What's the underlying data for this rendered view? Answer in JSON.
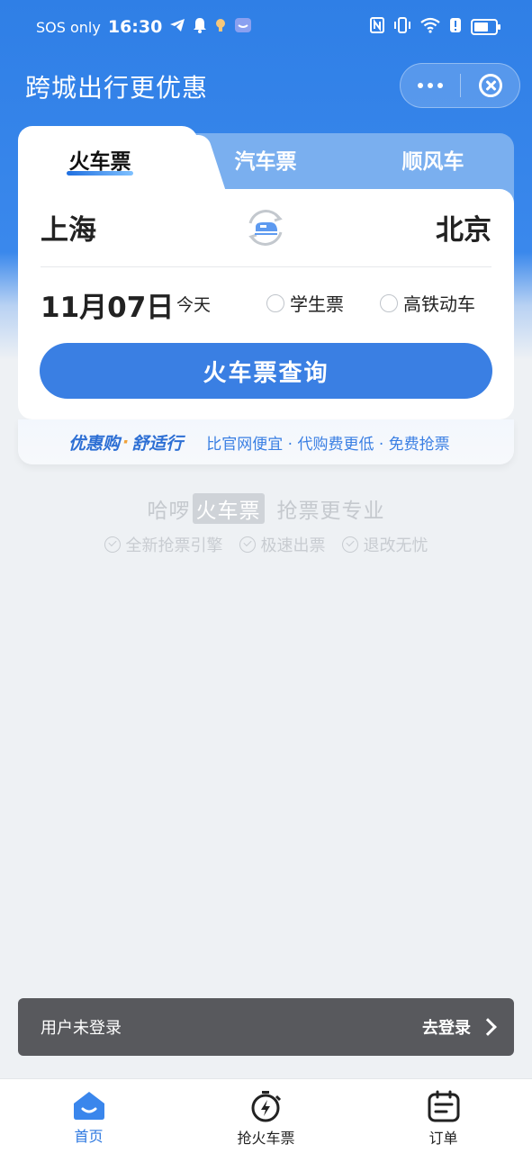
{
  "status_bar": {
    "left_text": "SOS only",
    "time": "16:30",
    "icons": [
      "telegram-icon",
      "bell-icon",
      "app-notification-icon",
      "app-notification-icon",
      "nfc-icon",
      "vibrate-icon",
      "wifi-icon",
      "alert-icon",
      "battery-icon"
    ]
  },
  "header": {
    "title": "跨城出行更优惠"
  },
  "tabs": [
    {
      "label": "火车票",
      "active": true
    },
    {
      "label": "汽车票",
      "active": false
    },
    {
      "label": "顺风车",
      "active": false
    }
  ],
  "search": {
    "from_city": "上海",
    "to_city": "北京",
    "date": "11月07日",
    "date_hint": "今天",
    "option_student": "学生票",
    "option_hsr": "高铁动车",
    "query_button": "火车票查询"
  },
  "promo": {
    "part1": "优惠购",
    "dot": "·",
    "part2": "舒适行",
    "tagline": "比官网便宜 · 代购费更低 · 免费抢票"
  },
  "brand": {
    "pre": "哈啰",
    "tag": "火车票",
    "slogan": "抢票更专业",
    "features": [
      "全新抢票引擎",
      "极速出票",
      "退改无忧"
    ]
  },
  "login_bar": {
    "text": "用户未登录",
    "link": "去登录"
  },
  "tabbar": [
    {
      "label": "首页",
      "icon": "home-icon",
      "active": true
    },
    {
      "label": "抢火车票",
      "icon": "stopwatch-bolt-icon",
      "active": false
    },
    {
      "label": "订单",
      "icon": "order-list-icon",
      "active": false
    }
  ],
  "colors": {
    "primary": "#3a7fe3",
    "header_bg": "#2f7fe6",
    "login_bar_bg": "#58595d"
  }
}
